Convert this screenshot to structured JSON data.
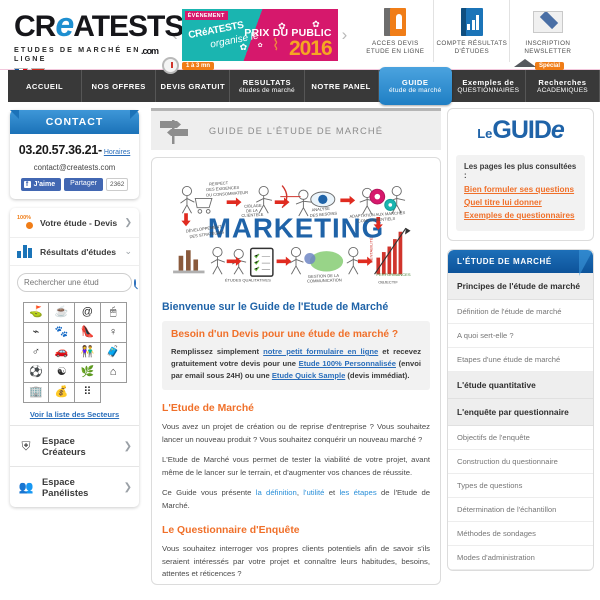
{
  "header": {
    "logo_main": "CR",
    "logo_e": "e",
    "logo_rest": "ATESTS",
    "logo_dotcom": ".com",
    "logo_sub": "ETUDES DE MARCHÉ EN LIGNE",
    "flags": [
      "flag-fr",
      "flag-ch"
    ],
    "prev_arrow": "‹",
    "next_arrow": "›",
    "promo": {
      "event_label": "ÉVÉNEMENT",
      "brand": "CRéATESTS",
      "organise": "organise le",
      "prize": "PRIX DU PUBLIC",
      "year": "2016"
    },
    "links": [
      {
        "icon": "book-icon",
        "line1": "ACCES DEVIS",
        "line2": "ETUDE EN LIGNE"
      },
      {
        "icon": "chart-book-icon",
        "line1": "COMPTE RÉSULTATS",
        "line2": "D'ÉTUDES"
      },
      {
        "icon": "envelope-icon",
        "line1": "INSCRIPTION",
        "line2": "NEWSLETTER"
      }
    ]
  },
  "nav": {
    "badge_clock": "1 à 3 mn",
    "badge_special": "Spécial",
    "items": [
      {
        "l1": "ACCUEIL",
        "l2": "",
        "active": false
      },
      {
        "l1": "NOS OFFRES",
        "l2": "",
        "active": false
      },
      {
        "l1": "DEVIS GRATUIT",
        "l2": "",
        "active": false
      },
      {
        "l1": "RESULTATS",
        "l2": "études de marché",
        "active": false
      },
      {
        "l1": "NOTRE PANEL",
        "l2": "",
        "active": false
      },
      {
        "l1": "GUIDE",
        "l2": "étude de marché",
        "active": true
      },
      {
        "l1": "Exemples de",
        "l2": "QUESTIONNAIRES",
        "active": false
      },
      {
        "l1": "Recherches",
        "l2": "ACADEMIQUES",
        "active": false
      }
    ]
  },
  "sidebar_left": {
    "contact": {
      "title": "CONTACT",
      "phone": "03.20.57.36.21",
      "dash": "-",
      "horaires": "Horaires",
      "email": "contact@creatests.com",
      "fb_like": "J'aime",
      "fb_f": "f",
      "fb_share": "Partager",
      "fb_count": "2362"
    },
    "menu": [
      {
        "icon": "percent-icon",
        "label": "Votre étude - Devis",
        "chevron": "❯"
      },
      {
        "icon": "bar-chart-icon",
        "label": "Résultats d'études",
        "chevron": "⌄"
      }
    ],
    "search": {
      "placeholder": "Rechercher une étud",
      "value": ""
    },
    "sectors": [
      "⛳",
      "☕",
      "@",
      "🖱",
      "⌁",
      "🐾",
      "👠",
      "♀",
      "♂",
      "🚗",
      "👫",
      "🧳",
      "⚽",
      "☯",
      "🌿",
      "⌂",
      "🏢",
      "💰",
      "⠿"
    ],
    "sectors_link": "Voir la liste des Secteurs",
    "espaces": [
      {
        "icon": "creators-icon",
        "label": "Espace Créateurs",
        "chevron": "❯"
      },
      {
        "icon": "panelists-icon",
        "label": "Espace Panélistes",
        "chevron": "❯"
      }
    ]
  },
  "main": {
    "breadcrumb_icon": "signpost-icon",
    "breadcrumb": "GUIDE DE L'ÉTUDE DE MARCHÉ",
    "hero_alt": "marketing-illustration",
    "hero_word": "MARKETING",
    "hero_labels": [
      "RESPECT DES EXIGENCES DU CONSOMMATEUR",
      "CIBLAGE DE LA CLIENTÈLE",
      "ANALYSE DES BESOINS",
      "ADAPTATION AUX MARCHÉS CONCURRENTIELS",
      "DÉVELOPPEMENT DES STRATÉGIES",
      "ÉTUDES QUALITATIVES",
      "GESTION DE LA COMMUNICATION",
      "PERFORMANCES",
      "OBJECTIF"
    ],
    "welcome": "Bienvenue sur le Guide de l'Etude de Marché",
    "devis": {
      "title": "Besoin d'un Devis pour une étude de marché ?",
      "p1a": "Remplissez simplement ",
      "link1": "notre petit formulaire en ligne",
      "p1b": " et recevez gratuitement votre devis pour une ",
      "link2": "Etude 100% Personnalisée",
      "p1c": " (envoi par email sous 24H) ou une ",
      "link3": "Etude Quick Sample",
      "p1d": " (devis immédiat)."
    },
    "section1": {
      "title": "L'Etude de Marché",
      "p1": "Vous avez un projet de création ou de reprise d'entreprise ? Vous souhaitez lancer un nouveau produit ? Vous souhaitez conquérir un nouveau marché ?",
      "p2": "L'Etude de Marché vous permet de tester la viabilité de votre projet, avant même de le lancer sur le terrain, et d'augmenter vos chances de réussite.",
      "p3a": "Ce Guide vous présente ",
      "l1": "la définition",
      "p3b": ", ",
      "l2": "l'utilité",
      "p3c": " et ",
      "l3": "les étapes",
      "p3d": " de l'Etude de Marché."
    },
    "section2": {
      "title": "Le Questionnaire d'Enquête",
      "p1": "Vous souhaitez interroger vos propres clients potentiels afin de savoir s'ils seraient intéressés par votre projet et connaître leurs habitudes, besoins, attentes et réticences ?"
    }
  },
  "sidebar_right": {
    "guide_logo_le": "Le",
    "guide_logo_guid": "GUID",
    "guide_logo_e": "e",
    "pages_title": "Les pages les plus consultées :",
    "pages": [
      "Bien formuler ses questions",
      "Quel titre lui donner",
      "Exemples de questionnaires"
    ],
    "nav_header": "L'ÉTUDE DE MARCHÉ",
    "nav_sections": [
      {
        "group": "Principes de l'étude de marché",
        "items": [
          "Définition de l'étude de marché",
          "A quoi sert-elle ?",
          "Etapes d'une étude de marché"
        ]
      },
      {
        "group": "L'étude quantitative",
        "items": []
      },
      {
        "group": "L'enquête par questionnaire",
        "items": [
          "Objectifs de l'enquête",
          "Construction du questionnaire",
          "Types de questions",
          "Détermination de l'échantillon",
          "Méthodes de sondages",
          "Modes d'administration"
        ]
      }
    ]
  },
  "colors": {
    "brand_blue": "#1f63a8",
    "accent_orange": "#f0702a",
    "nav_dark": "#393939",
    "link_blue": "#2a6ebb"
  }
}
